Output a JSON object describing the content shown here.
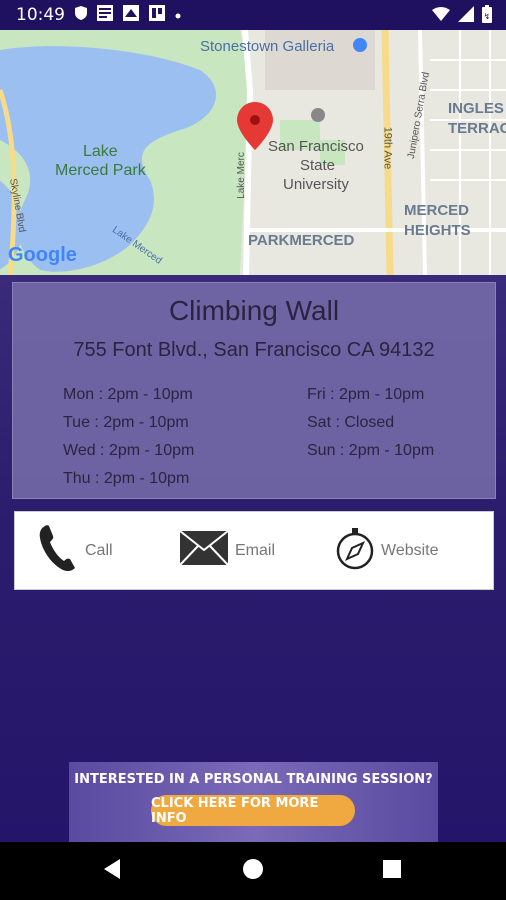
{
  "status_bar": {
    "time": "10:49"
  },
  "map": {
    "labels": {
      "stonestown": "Stonestown Galleria",
      "lake_merced_park": "Lake\nMerced Park",
      "sfsu_line1": "San Francisco",
      "sfsu_line2": "State",
      "sfsu_line3": "University",
      "parkmerced": "PARKMERCED",
      "merced_heights_1": "MERCED",
      "merced_heights_2": "HEIGHTS",
      "ingleside_1": "INGLES",
      "ingleside_2": "TERRAC",
      "nineteenth_ave": "19th Ave",
      "junipero_serra": "Junipero Serra Blvd",
      "skyline": "Skyline Blvd",
      "lake_merced_road": "Lake Merced",
      "lake_merced_vertical": "Lake Merc",
      "google": "Google"
    }
  },
  "facility": {
    "name": "Climbing Wall",
    "address": "755 Font Blvd., San Francisco CA 94132",
    "hours_left": [
      "Mon : 2pm - 10pm",
      "Tue : 2pm - 10pm",
      "Wed : 2pm - 10pm",
      "Thu : 2pm - 10pm"
    ],
    "hours_right": [
      "Fri : 2pm - 10pm",
      "Sat : Closed",
      "Sun : 2pm - 10pm"
    ]
  },
  "actions": {
    "call": "Call",
    "email": "Email",
    "website": "Website"
  },
  "banner": {
    "headline": "INTERESTED IN A PERSONAL TRAINING SESSION?",
    "button": "CLICK HERE FOR MORE INFO"
  },
  "colors": {
    "purple_bg": "#2a1a6e",
    "status_bar": "#1f1160",
    "banner_button": "#f0a840",
    "map_pin": "#e53935"
  }
}
